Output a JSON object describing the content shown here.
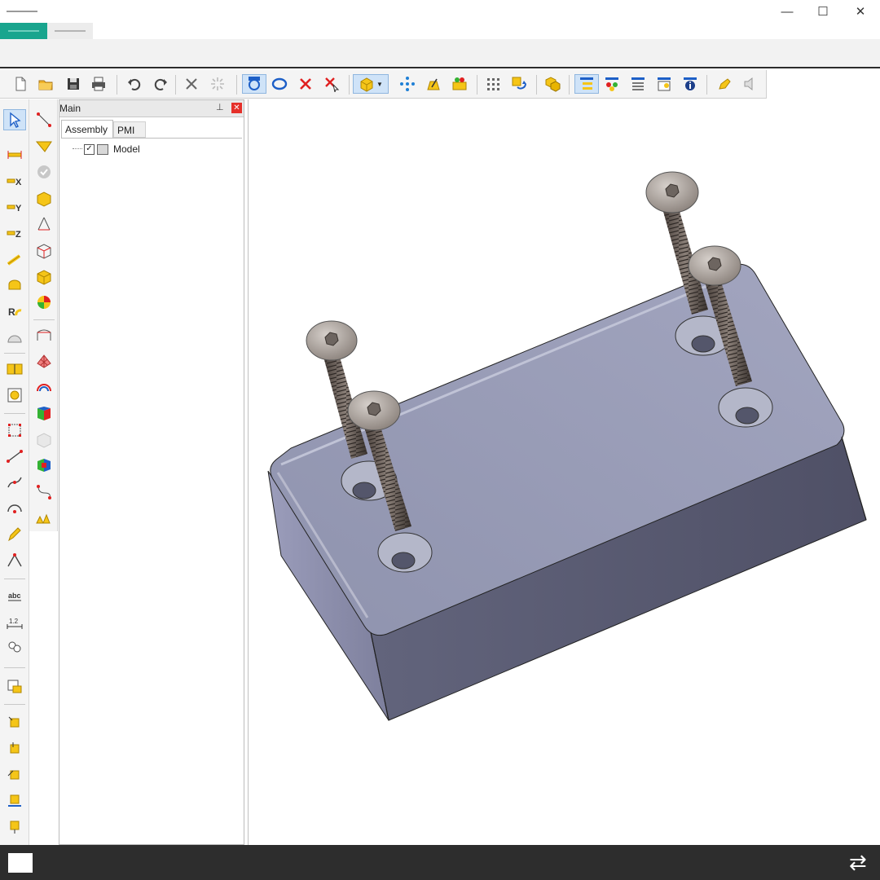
{
  "window": {
    "title": "",
    "controls": {
      "minimize": "—",
      "maximize": "☐",
      "close": "✕"
    },
    "tabs": [
      {
        "label": "",
        "active": true,
        "color": "#19a58e"
      },
      {
        "label": "",
        "active": false,
        "color": "#e8e8e8"
      }
    ]
  },
  "toolbar": {
    "groups": [
      [
        "new-file-icon",
        "open-folder-icon",
        "save-icon",
        "print-icon"
      ],
      [
        "undo-icon",
        "redo-icon"
      ],
      [
        "delete-icon",
        "explode-icon"
      ],
      [
        "auto-view-icon",
        "rotate-icon",
        "remove-red-icon",
        "remove-cursor-icon"
      ],
      [
        "cube-dropdown-icon",
        "points-icon",
        "edit-text-icon",
        "box-fill-icon"
      ],
      [
        "grid-icon",
        "refresh-icon"
      ],
      [
        "parts-icon"
      ],
      [
        "tree-view-icon",
        "color-tree-icon",
        "list-view-icon",
        "properties-icon",
        "info-icon"
      ],
      [
        "highlighter-icon",
        "audio-icon"
      ]
    ]
  },
  "panel": {
    "title": "Main",
    "pin": "⊥",
    "close": "✕",
    "tabs": [
      "Assembly",
      "PMI"
    ],
    "tree": [
      {
        "label": "Model",
        "checked": true
      }
    ]
  },
  "taskbar": {
    "switch_icon": "⇄"
  },
  "colors": {
    "accent": "#19a58e",
    "part_top": "#9599b4",
    "part_side": "#5b5d74",
    "screw": "#8a7f78"
  }
}
